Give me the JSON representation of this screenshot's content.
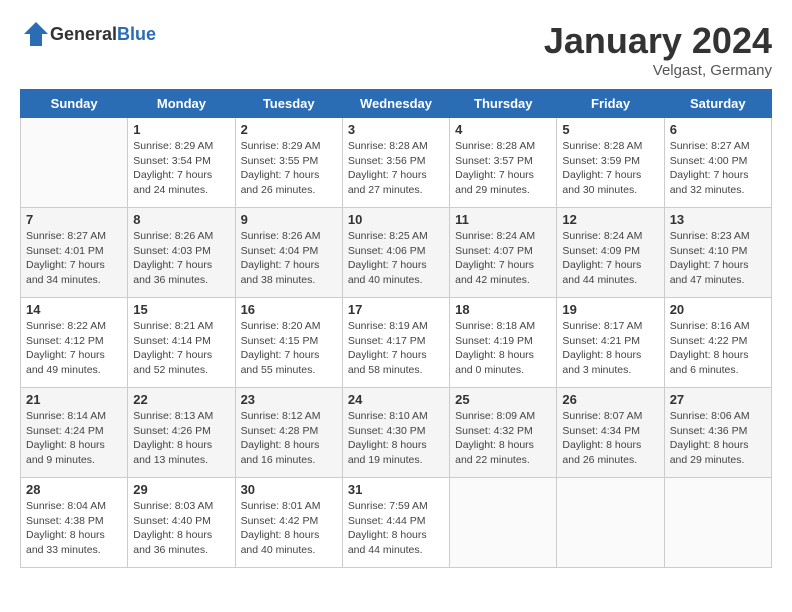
{
  "header": {
    "logo_general": "General",
    "logo_blue": "Blue",
    "month": "January 2024",
    "location": "Velgast, Germany"
  },
  "weekdays": [
    "Sunday",
    "Monday",
    "Tuesday",
    "Wednesday",
    "Thursday",
    "Friday",
    "Saturday"
  ],
  "weeks": [
    [
      {
        "day": "",
        "info": ""
      },
      {
        "day": "1",
        "info": "Sunrise: 8:29 AM\nSunset: 3:54 PM\nDaylight: 7 hours\nand 24 minutes."
      },
      {
        "day": "2",
        "info": "Sunrise: 8:29 AM\nSunset: 3:55 PM\nDaylight: 7 hours\nand 26 minutes."
      },
      {
        "day": "3",
        "info": "Sunrise: 8:28 AM\nSunset: 3:56 PM\nDaylight: 7 hours\nand 27 minutes."
      },
      {
        "day": "4",
        "info": "Sunrise: 8:28 AM\nSunset: 3:57 PM\nDaylight: 7 hours\nand 29 minutes."
      },
      {
        "day": "5",
        "info": "Sunrise: 8:28 AM\nSunset: 3:59 PM\nDaylight: 7 hours\nand 30 minutes."
      },
      {
        "day": "6",
        "info": "Sunrise: 8:27 AM\nSunset: 4:00 PM\nDaylight: 7 hours\nand 32 minutes."
      }
    ],
    [
      {
        "day": "7",
        "info": "Sunrise: 8:27 AM\nSunset: 4:01 PM\nDaylight: 7 hours\nand 34 minutes."
      },
      {
        "day": "8",
        "info": "Sunrise: 8:26 AM\nSunset: 4:03 PM\nDaylight: 7 hours\nand 36 minutes."
      },
      {
        "day": "9",
        "info": "Sunrise: 8:26 AM\nSunset: 4:04 PM\nDaylight: 7 hours\nand 38 minutes."
      },
      {
        "day": "10",
        "info": "Sunrise: 8:25 AM\nSunset: 4:06 PM\nDaylight: 7 hours\nand 40 minutes."
      },
      {
        "day": "11",
        "info": "Sunrise: 8:24 AM\nSunset: 4:07 PM\nDaylight: 7 hours\nand 42 minutes."
      },
      {
        "day": "12",
        "info": "Sunrise: 8:24 AM\nSunset: 4:09 PM\nDaylight: 7 hours\nand 44 minutes."
      },
      {
        "day": "13",
        "info": "Sunrise: 8:23 AM\nSunset: 4:10 PM\nDaylight: 7 hours\nand 47 minutes."
      }
    ],
    [
      {
        "day": "14",
        "info": "Sunrise: 8:22 AM\nSunset: 4:12 PM\nDaylight: 7 hours\nand 49 minutes."
      },
      {
        "day": "15",
        "info": "Sunrise: 8:21 AM\nSunset: 4:14 PM\nDaylight: 7 hours\nand 52 minutes."
      },
      {
        "day": "16",
        "info": "Sunrise: 8:20 AM\nSunset: 4:15 PM\nDaylight: 7 hours\nand 55 minutes."
      },
      {
        "day": "17",
        "info": "Sunrise: 8:19 AM\nSunset: 4:17 PM\nDaylight: 7 hours\nand 58 minutes."
      },
      {
        "day": "18",
        "info": "Sunrise: 8:18 AM\nSunset: 4:19 PM\nDaylight: 8 hours\nand 0 minutes."
      },
      {
        "day": "19",
        "info": "Sunrise: 8:17 AM\nSunset: 4:21 PM\nDaylight: 8 hours\nand 3 minutes."
      },
      {
        "day": "20",
        "info": "Sunrise: 8:16 AM\nSunset: 4:22 PM\nDaylight: 8 hours\nand 6 minutes."
      }
    ],
    [
      {
        "day": "21",
        "info": "Sunrise: 8:14 AM\nSunset: 4:24 PM\nDaylight: 8 hours\nand 9 minutes."
      },
      {
        "day": "22",
        "info": "Sunrise: 8:13 AM\nSunset: 4:26 PM\nDaylight: 8 hours\nand 13 minutes."
      },
      {
        "day": "23",
        "info": "Sunrise: 8:12 AM\nSunset: 4:28 PM\nDaylight: 8 hours\nand 16 minutes."
      },
      {
        "day": "24",
        "info": "Sunrise: 8:10 AM\nSunset: 4:30 PM\nDaylight: 8 hours\nand 19 minutes."
      },
      {
        "day": "25",
        "info": "Sunrise: 8:09 AM\nSunset: 4:32 PM\nDaylight: 8 hours\nand 22 minutes."
      },
      {
        "day": "26",
        "info": "Sunrise: 8:07 AM\nSunset: 4:34 PM\nDaylight: 8 hours\nand 26 minutes."
      },
      {
        "day": "27",
        "info": "Sunrise: 8:06 AM\nSunset: 4:36 PM\nDaylight: 8 hours\nand 29 minutes."
      }
    ],
    [
      {
        "day": "28",
        "info": "Sunrise: 8:04 AM\nSunset: 4:38 PM\nDaylight: 8 hours\nand 33 minutes."
      },
      {
        "day": "29",
        "info": "Sunrise: 8:03 AM\nSunset: 4:40 PM\nDaylight: 8 hours\nand 36 minutes."
      },
      {
        "day": "30",
        "info": "Sunrise: 8:01 AM\nSunset: 4:42 PM\nDaylight: 8 hours\nand 40 minutes."
      },
      {
        "day": "31",
        "info": "Sunrise: 7:59 AM\nSunset: 4:44 PM\nDaylight: 8 hours\nand 44 minutes."
      },
      {
        "day": "",
        "info": ""
      },
      {
        "day": "",
        "info": ""
      },
      {
        "day": "",
        "info": ""
      }
    ]
  ]
}
